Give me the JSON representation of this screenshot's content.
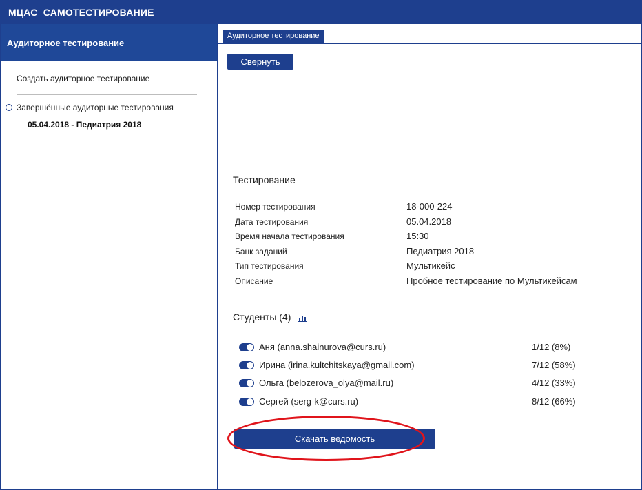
{
  "app": {
    "title": "МЦАС  САМОТЕСТИРОВАНИЕ"
  },
  "sidebar": {
    "header": "Аудиторное тестирование",
    "create_link": "Создать аудиторное тестирование",
    "tree_root": "Завершённые аудиторные тестирования",
    "tree_item": "05.04.2018 - Педиатрия 2018"
  },
  "main": {
    "tab_label": "Аудиторное тестирование",
    "collapse_label": "Свернуть",
    "testing_title": "Тестирование",
    "info": [
      {
        "label": "Номер тестирования",
        "value": "18-000-224"
      },
      {
        "label": "Дата тестирования",
        "value": "05.04.2018"
      },
      {
        "label": "Время начала тестирования",
        "value": "15:30"
      },
      {
        "label": "Банк заданий",
        "value": "Педиатрия 2018"
      },
      {
        "label": "Тип тестирования",
        "value": "Мультикейс"
      },
      {
        "label": "Описание",
        "value": "Пробное тестирование по Мультикейсам"
      }
    ],
    "students_title": "Студенты (4)",
    "students": [
      {
        "name": "Аня (anna.shainurova@curs.ru)",
        "score": "1/12 (8%)",
        "enabled": true
      },
      {
        "name": "Ирина (irina.kultchitskaya@gmail.com)",
        "score": "7/12 (58%)",
        "enabled": true
      },
      {
        "name": "Ольга (belozerova_olya@mail.ru)",
        "score": "4/12 (33%)",
        "enabled": true
      },
      {
        "name": "Сергей (serg-k@curs.ru)",
        "score": "8/12 (66%)",
        "enabled": true
      }
    ],
    "download_label": "Скачать ведомость"
  },
  "colors": {
    "brand": "#1e3f8e",
    "annotation": "#e0141b"
  },
  "icons": {
    "tree_collapse": "minus-icon",
    "stats": "bar-chart-icon"
  }
}
